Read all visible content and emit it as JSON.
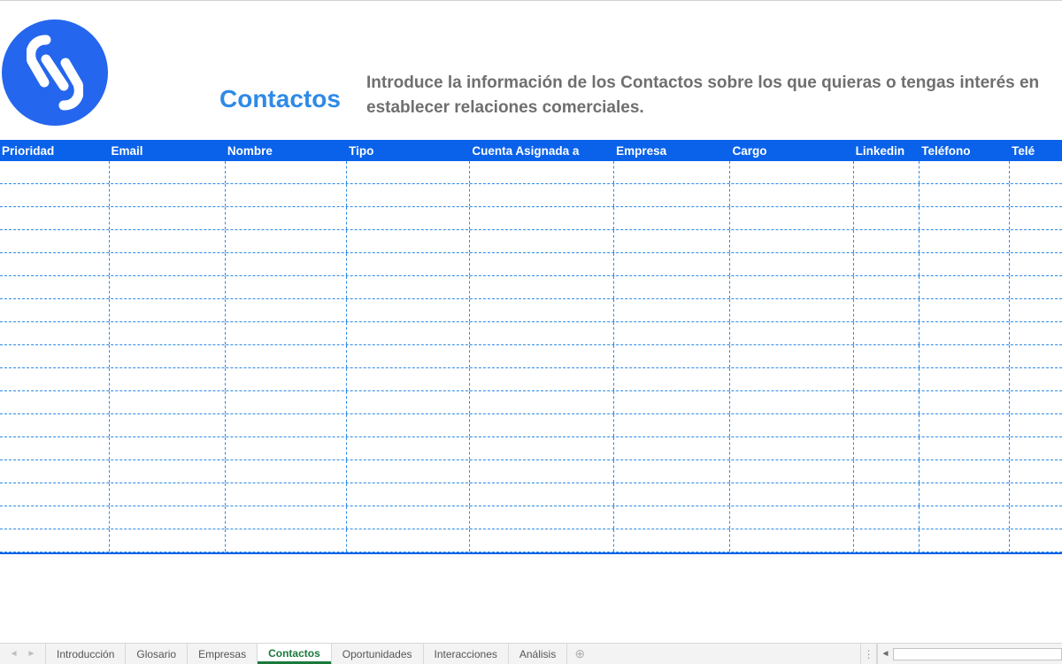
{
  "header": {
    "title": "Contactos",
    "description": "Introduce la información de los Contactos sobre los que quieras o tengas interés en establecer relaciones comerciales."
  },
  "columns": [
    "Prioridad",
    "Email",
    "Nombre",
    "Tipo",
    "Cuenta Asignada a",
    "Empresa",
    "Cargo",
    "Linkedin",
    "Teléfono",
    "Telé"
  ],
  "row_count": 17,
  "sheet_tabs": {
    "items": [
      {
        "label": "Introducción",
        "active": false
      },
      {
        "label": "Glosario",
        "active": false
      },
      {
        "label": "Empresas",
        "active": false
      },
      {
        "label": "Contactos",
        "active": true
      },
      {
        "label": "Oportunidades",
        "active": false
      },
      {
        "label": "Interacciones",
        "active": false
      },
      {
        "label": "Análisis",
        "active": false
      }
    ]
  },
  "colors": {
    "brand_blue": "#2566ee",
    "header_blue": "#0a62ea",
    "title_blue": "#2e8ae6",
    "tab_active_green": "#1a7a3c"
  }
}
